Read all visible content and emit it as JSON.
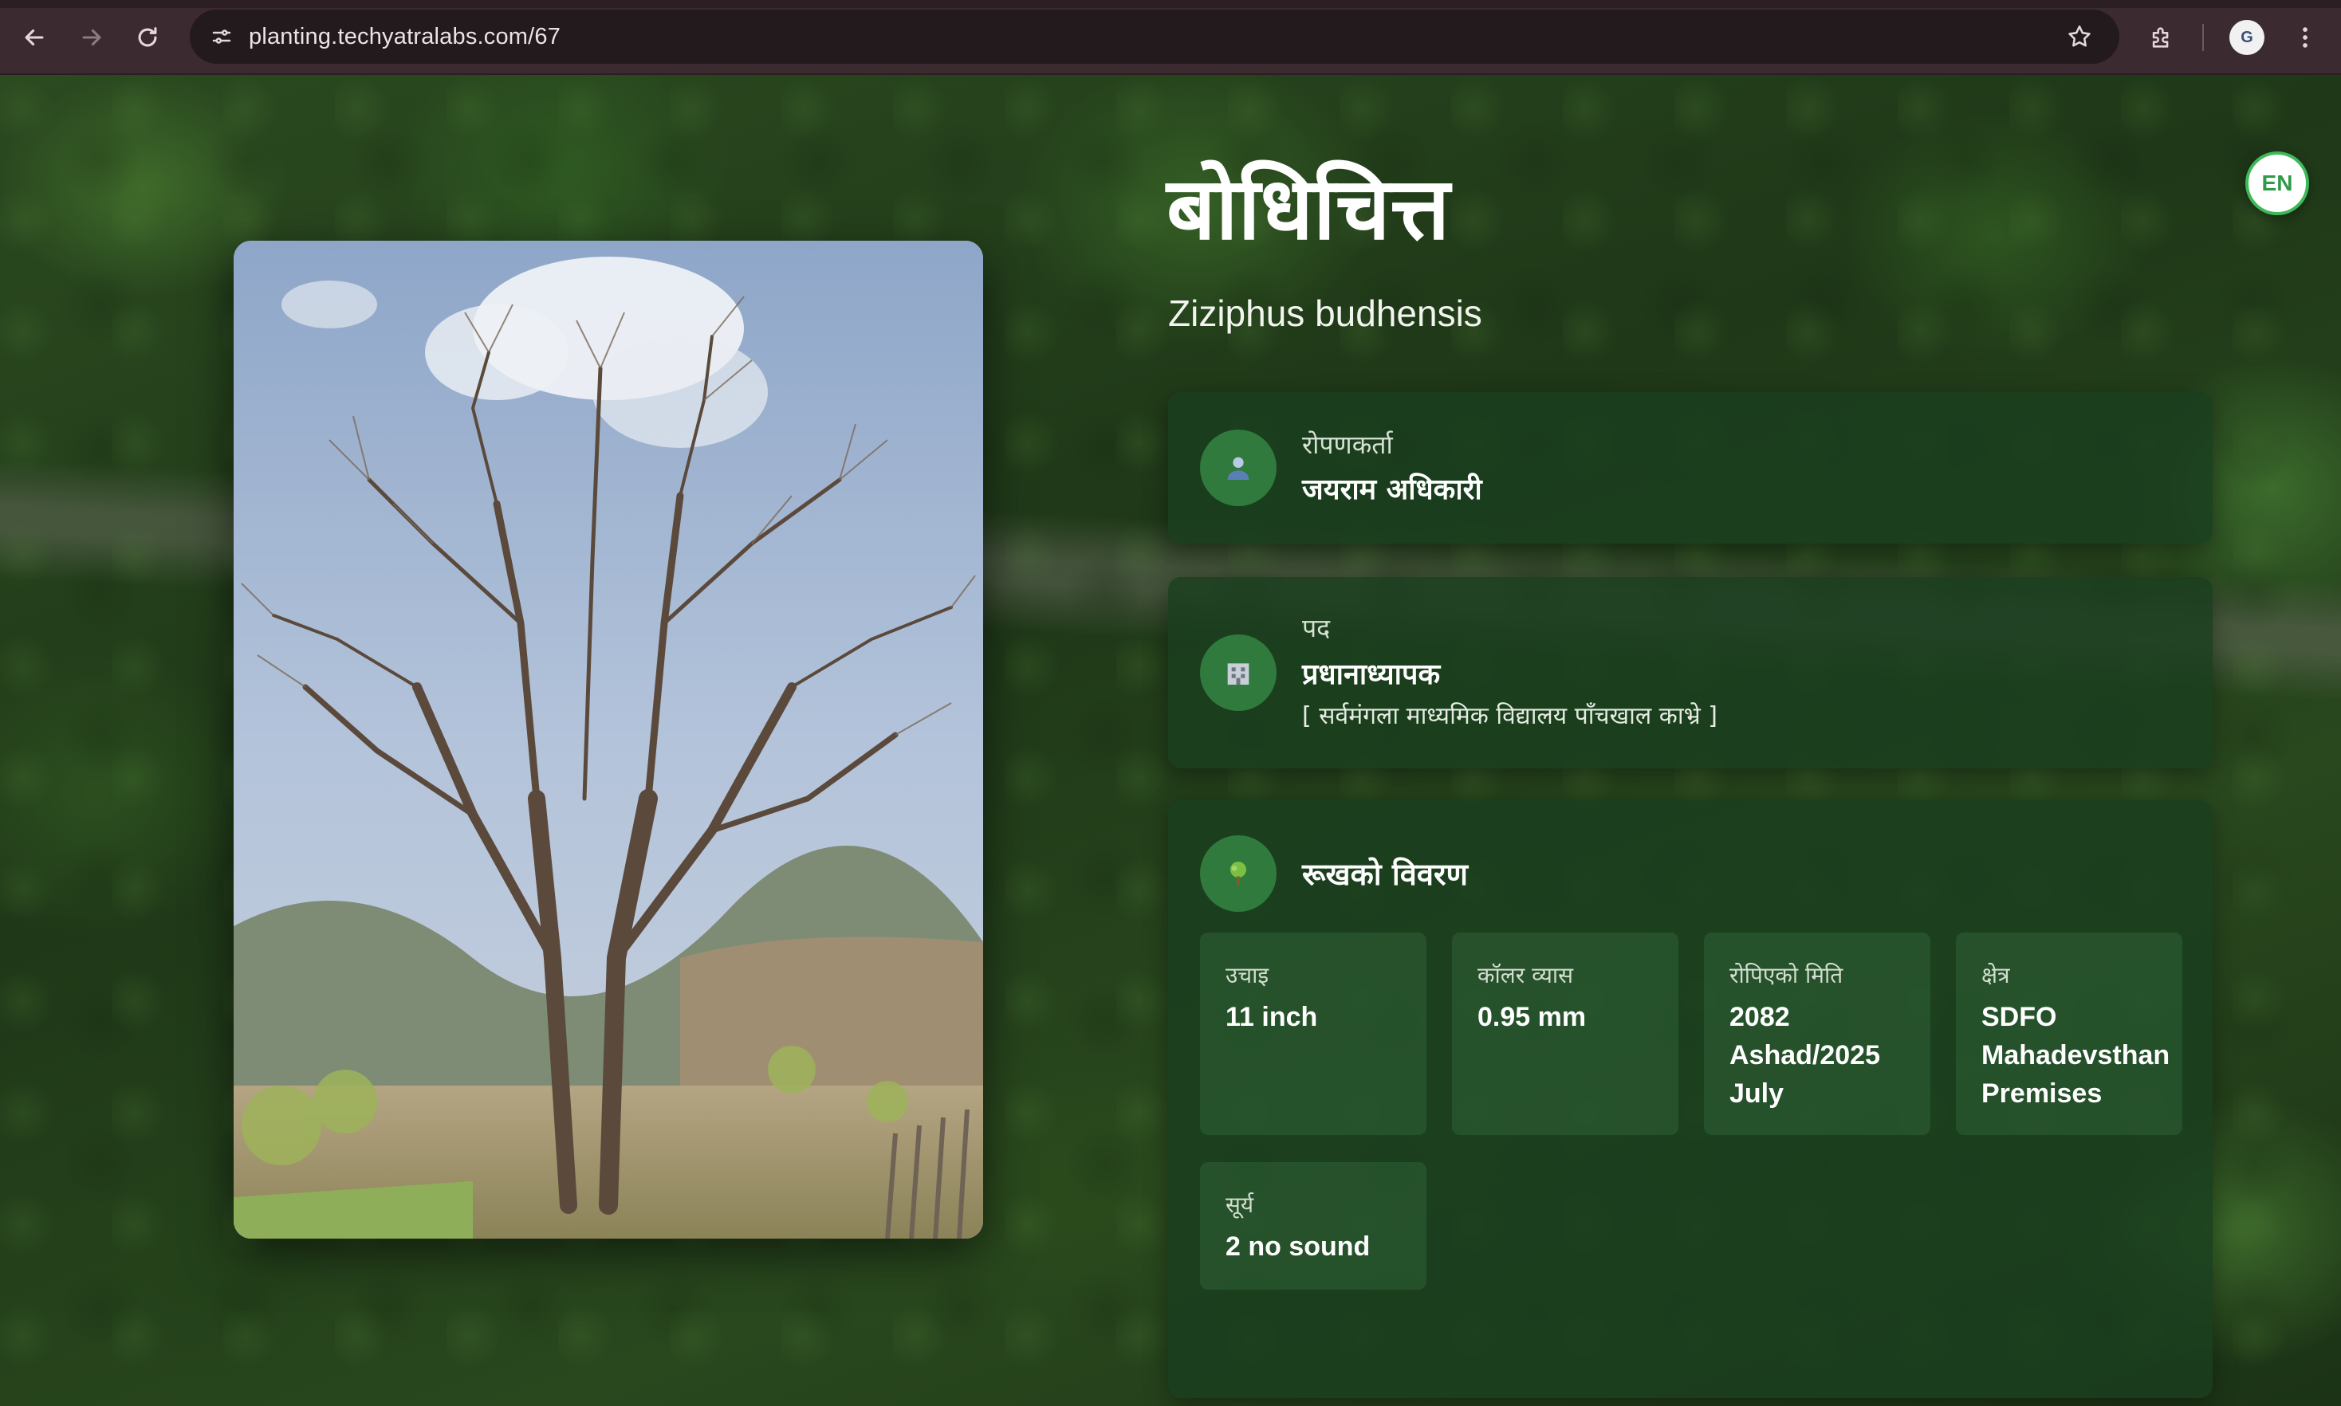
{
  "browser": {
    "url": "planting.techyatralabs.com/67",
    "profile_initial": "G",
    "icons": {
      "back": "arrow-left-icon",
      "forward": "arrow-right-icon",
      "reload": "reload-icon",
      "site_info": "tune-icon",
      "bookmark": "star-icon",
      "extensions": "puzzle-icon",
      "menu": "kebab-menu-icon"
    }
  },
  "page": {
    "title": "बोधिचित्त",
    "scientific_name": "Ziziphus budhensis",
    "language_toggle": "EN",
    "planter": {
      "label": "रोपणकर्ता",
      "name": "जयराम अधिकारी",
      "icon": "person-icon"
    },
    "position": {
      "label": "पद",
      "value": "प्रधानाध्यापक",
      "organization": "[ सर्वमंगला माध्यमिक विद्यालय पाँचखाल काभ्रे ]",
      "icon": "building-icon"
    },
    "tree_details": {
      "heading": "रूखको विवरण",
      "icon": "tree-icon",
      "stats": [
        {
          "label": "उचाइ",
          "value": "11 inch"
        },
        {
          "label": "कॉलर व्यास",
          "value": "0.95 mm"
        },
        {
          "label": "रोपिएको मिति",
          "value": "2082 Ashad/2025 July"
        },
        {
          "label": "क्षेत्र",
          "value": "SDFO Mahadevsthan Premises"
        },
        {
          "label": "सूर्य",
          "value": "2 no sound"
        }
      ]
    }
  },
  "colors": {
    "card_bg": "#1a3e1e",
    "icon_circle": "#2f7a3c",
    "accent_green": "#3fb85a",
    "chrome_bg": "#3b2a30"
  }
}
